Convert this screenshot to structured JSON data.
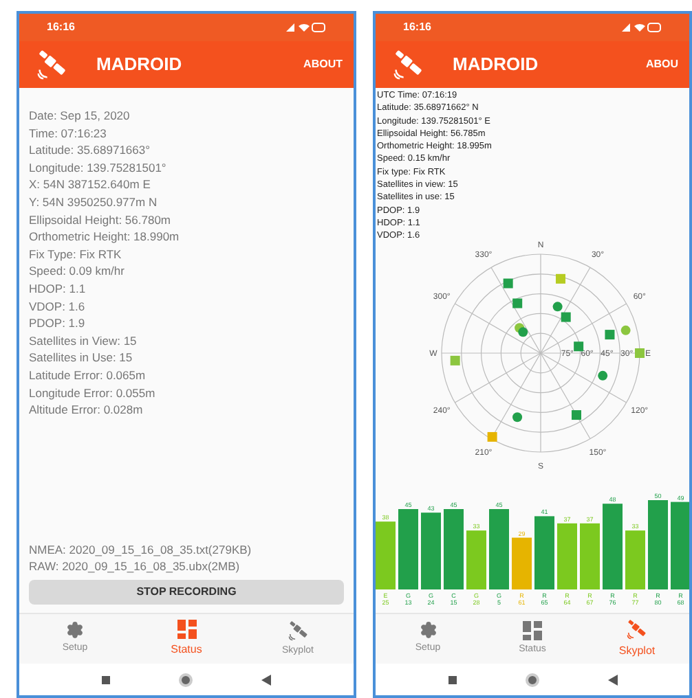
{
  "screens": [
    {
      "kind": "status",
      "status_bar": {
        "time": "16:16"
      },
      "app_bar": {
        "title": "MADROID",
        "action": "ABOUT"
      },
      "lines": [
        "Date: Sep 15, 2020",
        "Time: 07:16:23",
        "Latitude: 35.68971663°",
        "Longitude: 139.75281501°",
        "X: 54N 387152.640m E",
        "Y: 54N 3950250.977m N",
        "Ellipsoidal Height: 56.780m",
        "Orthometric Height: 18.990m",
        "Fix Type: Fix RTK",
        "Speed: 0.09 km/hr",
        "HDOP: 1.1",
        "VDOP: 1.6",
        "PDOP: 1.9",
        "Satellites in View: 15",
        "Satellites in Use: 15",
        "Latitude Error: 0.065m",
        "Longitude Error: 0.055m",
        "Altitude Error: 0.028m"
      ],
      "files": [
        "NMEA: 2020_09_15_16_08_35.txt(279KB)",
        "RAW: 2020_09_15_16_08_35.ubx(2MB)"
      ],
      "button": "STOP RECORDING",
      "nav_tabs": [
        {
          "kind": "setup",
          "label": "Setup",
          "selected": false
        },
        {
          "kind": "status",
          "label": "Status",
          "selected": true
        },
        {
          "kind": "skyplot",
          "label": "Skyplot",
          "selected": false
        }
      ]
    },
    {
      "kind": "skyplot",
      "status_bar": {
        "time": "16:16"
      },
      "app_bar": {
        "title": "MADROID",
        "action": "ABOU"
      },
      "lines": [
        "UTC Time: 07:16:19",
        "Latitude: 35.68971662° N",
        "Longitude: 139.75281501° E",
        "Ellipsoidal Height: 56.785m",
        "Orthometric Height: 18.995m",
        "Speed: 0.15 km/hr",
        "Fix type: Fix RTK",
        "Satellites in view: 15",
        "Satellites in use: 15",
        "PDOP: 1.9",
        "HDOP: 1.1",
        "VDOP: 1.6"
      ],
      "skyplot": {
        "compass": [
          "N",
          "E",
          "S",
          "W"
        ],
        "azimuth_labels": [
          "330°",
          "30°",
          "300°",
          "60°",
          "240°",
          "120°",
          "210°",
          "150°"
        ],
        "elevation_labels": [
          "75°",
          "60°",
          "45°",
          "30°"
        ]
      },
      "chart_data": {
        "type": "bar",
        "categories": [
          "E 25",
          "G 13",
          "G 24",
          "C 15",
          "G 28",
          "G 5",
          "R 61",
          "R 65",
          "R 64",
          "R 67",
          "R 76",
          "R 77",
          "R 80",
          "R 68"
        ],
        "series": [
          {
            "color": "#22a04b",
            "values": [
              null,
              45,
              43,
              45,
              null,
              45,
              null,
              41,
              null,
              null,
              48,
              null,
              50,
              49
            ]
          },
          {
            "color": "#7cc91f",
            "values": [
              38,
              null,
              null,
              null,
              33,
              null,
              null,
              null,
              37,
              37,
              null,
              33,
              null,
              null
            ]
          },
          {
            "color": "#e6b400",
            "values": [
              null,
              null,
              null,
              null,
              null,
              null,
              29,
              null,
              null,
              null,
              null,
              null,
              null,
              null
            ]
          }
        ],
        "data_labels": true
      },
      "nav_tabs": [
        {
          "kind": "setup",
          "label": "Setup",
          "selected": false
        },
        {
          "kind": "status",
          "label": "Status",
          "selected": false
        },
        {
          "kind": "skyplot",
          "label": "Skyplot",
          "selected": true
        }
      ]
    }
  ]
}
